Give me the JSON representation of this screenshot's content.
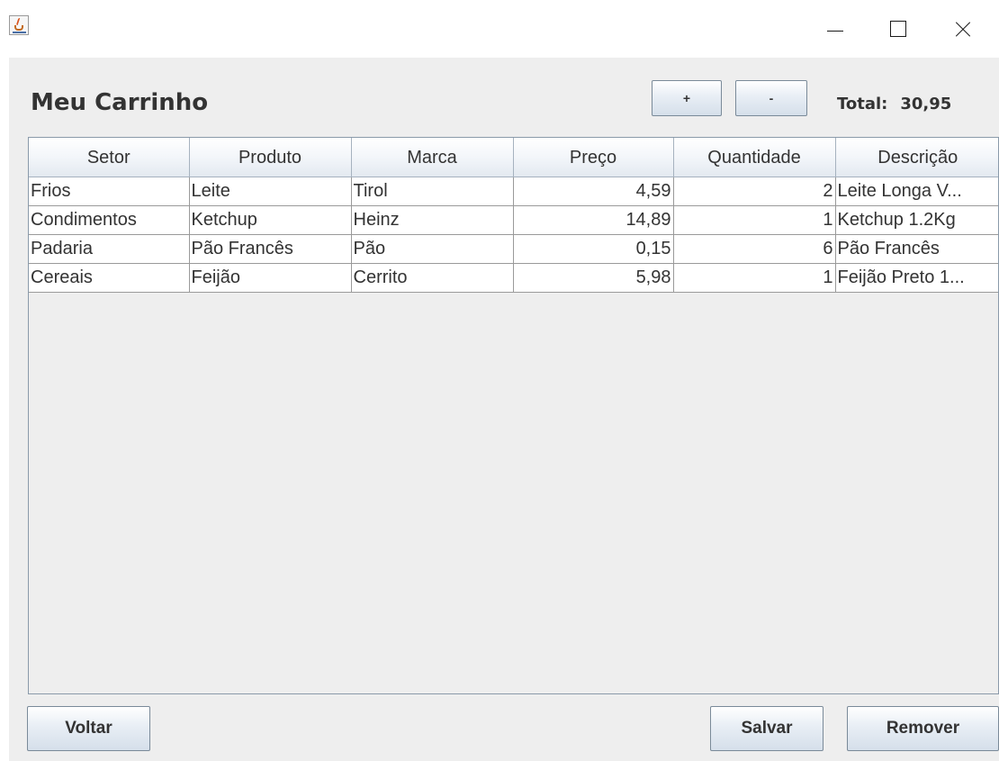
{
  "window": {
    "icon": "java-icon",
    "controls": [
      "minimize-icon",
      "maximize-icon",
      "close-icon"
    ]
  },
  "header": {
    "title": "Meu Carrinho",
    "plus_label": "+",
    "minus_label": "-",
    "total_label": "Total:",
    "total_value": "30,95"
  },
  "table": {
    "columns": [
      "Setor",
      "Produto",
      "Marca",
      "Preço",
      "Quantidade",
      "Descrição"
    ],
    "rows": [
      [
        "Frios",
        "Leite",
        "Tirol",
        "4,59",
        "2",
        "Leite Longa V..."
      ],
      [
        "Condimentos",
        "Ketchup",
        "Heinz",
        "14,89",
        "1",
        "Ketchup 1.2Kg"
      ],
      [
        "Padaria",
        "Pão Francês",
        "Pão",
        "0,15",
        "6",
        "Pão Francês"
      ],
      [
        "Cereais",
        "Feijão",
        "Cerrito",
        "5,98",
        "1",
        "Feijão Preto 1..."
      ]
    ]
  },
  "footer": {
    "back_label": "Voltar",
    "save_label": "Salvar",
    "remove_label": "Remover"
  }
}
